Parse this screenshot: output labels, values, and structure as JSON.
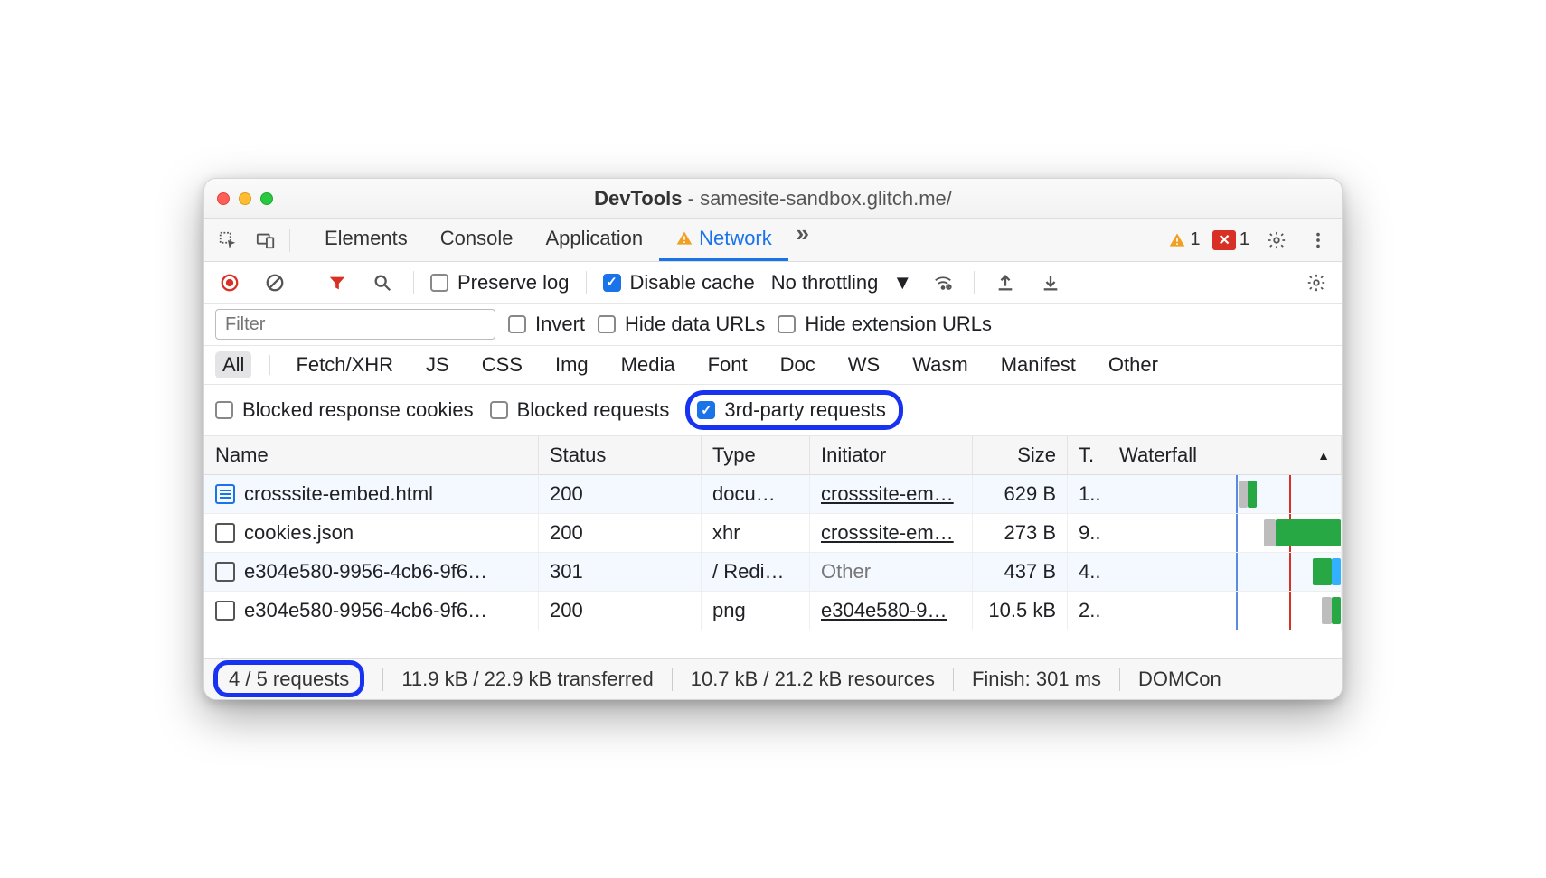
{
  "window_title": {
    "app": "DevTools",
    "page": "samesite-sandbox.glitch.me/"
  },
  "main_tabs": {
    "elements": "Elements",
    "console": "Console",
    "application": "Application",
    "network": "Network"
  },
  "counts": {
    "warnings": "1",
    "errors": "1"
  },
  "toolbar": {
    "preserve_log": "Preserve log",
    "disable_cache": "Disable cache",
    "throttling": "No throttling"
  },
  "filter": {
    "placeholder": "Filter",
    "invert": "Invert",
    "hide_data": "Hide data URLs",
    "hide_ext": "Hide extension URLs"
  },
  "types": {
    "all": "All",
    "fetch": "Fetch/XHR",
    "js": "JS",
    "css": "CSS",
    "img": "Img",
    "media": "Media",
    "font": "Font",
    "doc": "Doc",
    "ws": "WS",
    "wasm": "Wasm",
    "manifest": "Manifest",
    "other": "Other"
  },
  "extra_filters": {
    "blocked_cookies": "Blocked response cookies",
    "blocked_req": "Blocked requests",
    "third_party": "3rd-party requests"
  },
  "columns": {
    "name": "Name",
    "status": "Status",
    "type": "Type",
    "initiator": "Initiator",
    "size": "Size",
    "time": "T.",
    "waterfall": "Waterfall",
    "sort": "▲"
  },
  "rows": [
    {
      "icon": "doc",
      "name": "crosssite-embed.html",
      "status": "200",
      "type": "docu…",
      "initiator": "crosssite-em…",
      "initiator_muted": false,
      "size": "629 B",
      "time": "1.."
    },
    {
      "icon": "sq",
      "name": "cookies.json",
      "status": "200",
      "type": "xhr",
      "initiator": "crosssite-em…",
      "initiator_muted": false,
      "size": "273 B",
      "time": "9.."
    },
    {
      "icon": "sq",
      "name": "e304e580-9956-4cb6-9f6…",
      "status": "301",
      "type": "/ Redi…",
      "initiator": "Other",
      "initiator_muted": true,
      "size": "437 B",
      "time": "4.."
    },
    {
      "icon": "sq",
      "name": "e304e580-9956-4cb6-9f6…",
      "status": "200",
      "type": "png",
      "initiator": "e304e580-9…",
      "initiator_muted": false,
      "size": "10.5 kB",
      "time": "2.."
    }
  ],
  "status": {
    "requests": "4 / 5 requests",
    "transferred": "11.9 kB / 22.9 kB transferred",
    "resources": "10.7 kB / 21.2 kB resources",
    "finish": "Finish: 301 ms",
    "domcontent": "DOMCon"
  }
}
